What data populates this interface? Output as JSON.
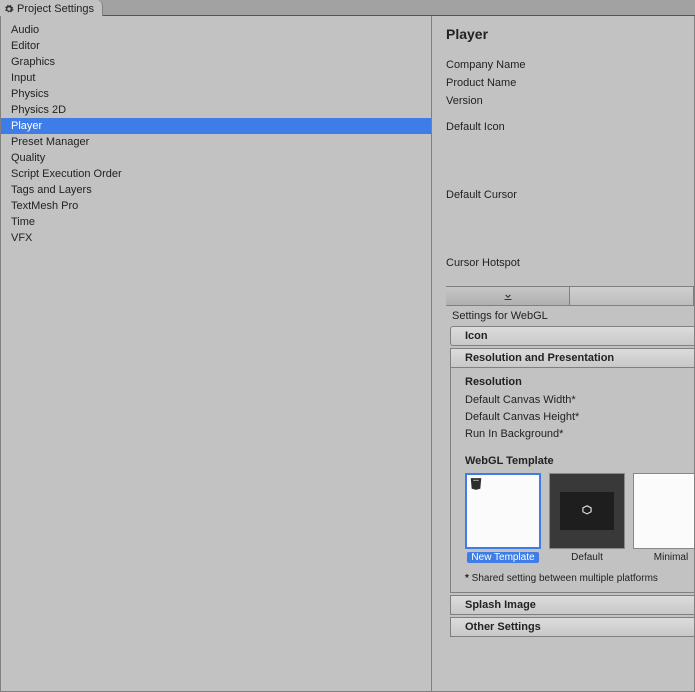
{
  "window": {
    "title": "Project Settings"
  },
  "sidebar": {
    "items": [
      {
        "label": "Audio"
      },
      {
        "label": "Editor"
      },
      {
        "label": "Graphics"
      },
      {
        "label": "Input"
      },
      {
        "label": "Physics"
      },
      {
        "label": "Physics 2D"
      },
      {
        "label": "Player",
        "selected": true
      },
      {
        "label": "Preset Manager"
      },
      {
        "label": "Quality"
      },
      {
        "label": "Script Execution Order"
      },
      {
        "label": "Tags and Layers"
      },
      {
        "label": "TextMesh Pro"
      },
      {
        "label": "Time"
      },
      {
        "label": "VFX"
      }
    ]
  },
  "player": {
    "title": "Player",
    "fields": {
      "company": "Company Name",
      "product": "Product Name",
      "version": "Version",
      "defaultIcon": "Default Icon",
      "defaultCursor": "Default Cursor",
      "cursorHotspot": "Cursor Hotspot"
    },
    "settingsFor": "Settings for WebGL",
    "sections": {
      "icon": "Icon",
      "resPres": "Resolution and Presentation",
      "resolution": "Resolution",
      "canvasWidth": "Default Canvas Width*",
      "canvasHeight": "Default Canvas Height*",
      "runInBg": "Run In Background*",
      "webglTemplate": "WebGL Template",
      "splash": "Splash Image",
      "other": "Other Settings"
    },
    "templates": [
      {
        "label": "New Template",
        "selected": true,
        "kind": "custom"
      },
      {
        "label": "Default",
        "kind": "default"
      },
      {
        "label": "Minimal",
        "kind": "minimal"
      }
    ],
    "footnote_star": "*",
    "footnote": " Shared setting between multiple platforms"
  }
}
